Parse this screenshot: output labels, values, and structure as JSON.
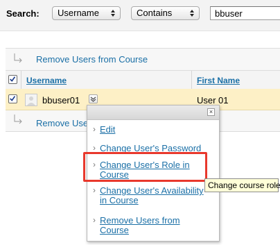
{
  "search": {
    "label": "Search:",
    "field_selected": "Username",
    "operator_selected": "Contains",
    "query_value": "bbuser"
  },
  "actions": {
    "remove_users_label": "Remove Users from Course",
    "bottom_remove_label": "Remove Use"
  },
  "table": {
    "columns": [
      "Username",
      "First Name"
    ],
    "rows": [
      {
        "username": "bbuser01",
        "first_name": "User 01",
        "selected": true
      }
    ]
  },
  "context_menu": {
    "close_label": "×",
    "items": [
      {
        "label": "Edit"
      },
      {
        "label": "Change User's Password"
      },
      {
        "label_line1": "Change User's Role in",
        "label_line2": "Course",
        "highlighted": true
      },
      {
        "label_line1": "Change User's Availability",
        "label_line2": "in Course"
      },
      {
        "label_line1": "Remove Users from",
        "label_line2": "Course"
      }
    ]
  },
  "tooltip": {
    "text": "Change course role"
  },
  "colors": {
    "link": "#1a6fa6",
    "row_highlight": "#fdf0c6",
    "annotation_red": "#e8382c",
    "tooltip_bg": "#ffffd8"
  }
}
